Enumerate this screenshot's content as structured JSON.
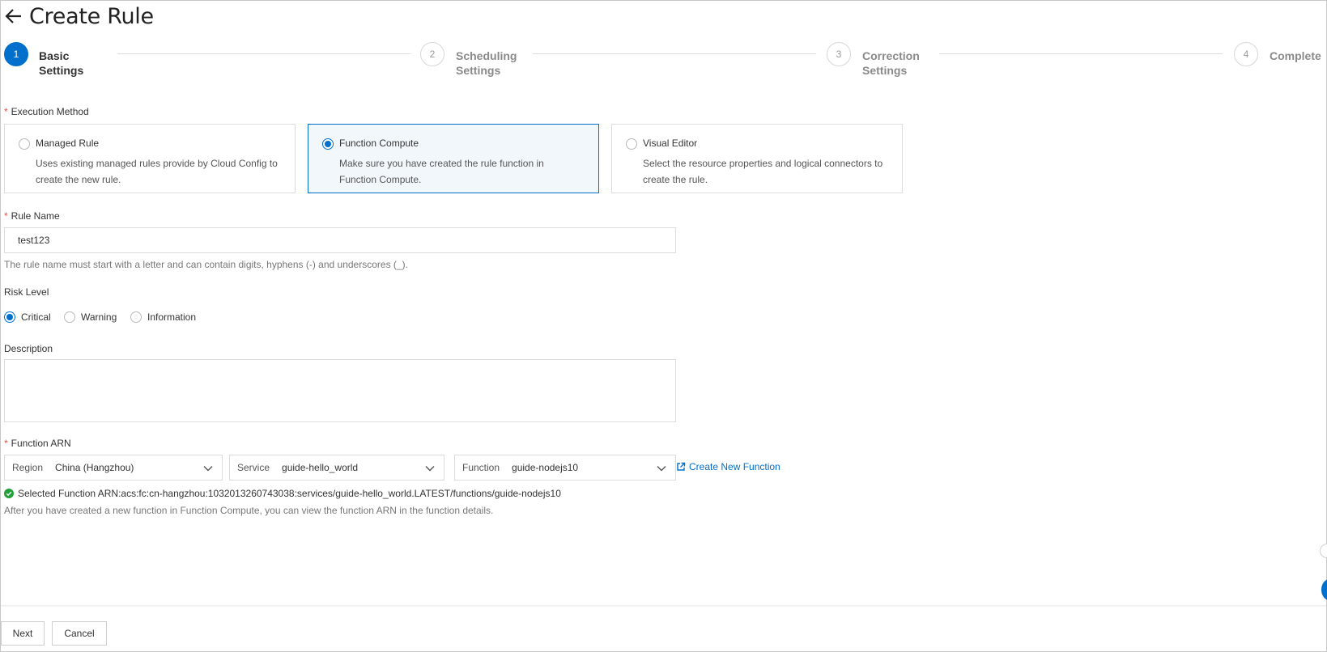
{
  "page": {
    "title": "Create Rule"
  },
  "steps": [
    {
      "number": "1",
      "line1": "Basic",
      "line2": "Settings",
      "active": true
    },
    {
      "number": "2",
      "line1": "Scheduling",
      "line2": "Settings",
      "active": false
    },
    {
      "number": "3",
      "line1": "Correction",
      "line2": "Settings",
      "active": false
    },
    {
      "number": "4",
      "line1": "Complete",
      "line2": "",
      "active": false
    }
  ],
  "execution_method": {
    "label": "Execution Method",
    "required": "*",
    "selected": "Function Compute",
    "options": [
      {
        "title": "Managed Rule",
        "description": "Uses existing managed rules provide by Cloud Config to create the new rule."
      },
      {
        "title": "Function Compute",
        "description": "Make sure you have created the rule function in Function Compute."
      },
      {
        "title": "Visual Editor",
        "description": "Select the resource properties and logical connectors to create the rule."
      }
    ]
  },
  "rule_name": {
    "label": "Rule Name",
    "required": "*",
    "value": "test123",
    "help": "The rule name must start with a letter and can contain digits, hyphens (-) and underscores (_)."
  },
  "risk_level": {
    "label": "Risk Level",
    "selected": "Critical",
    "options": [
      "Critical",
      "Warning",
      "Information"
    ]
  },
  "description": {
    "label": "Description",
    "value": ""
  },
  "function_arn": {
    "label": "Function ARN",
    "required": "*",
    "region": {
      "label": "Region",
      "value": "China (Hangzhou)"
    },
    "service": {
      "label": "Service",
      "value": "guide-hello_world"
    },
    "function": {
      "label": "Function",
      "value": "guide-nodejs10"
    },
    "create_link": "Create New Function",
    "selected_text": "Selected Function ARN:acs:fc:cn-hangzhou:1032013260743038:services/guide-hello_world.LATEST/functions/guide-nodejs10",
    "help": "After you have created a new function in Function Compute, you can view the function ARN in the function details."
  },
  "footer": {
    "next_label": "Next",
    "cancel_label": "Cancel"
  },
  "colors": {
    "accent": "#0070cc",
    "required": "#e84c3d",
    "success": "#23a03a"
  },
  "icons": [
    "back-arrow-icon",
    "chevron-down-icon",
    "external-link-icon",
    "check-circle-icon"
  ]
}
